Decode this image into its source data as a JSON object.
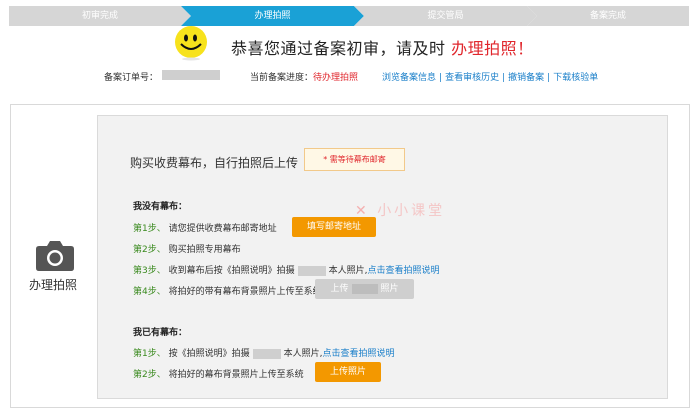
{
  "steps": [
    {
      "label": "初审完成",
      "color": "#d6d6d6"
    },
    {
      "label": "办理拍照",
      "color": "#1aa1d6"
    },
    {
      "label": "提交管局",
      "color": "#d6d6d6"
    },
    {
      "label": "备案完成",
      "color": "#d6d6d6"
    }
  ],
  "header": {
    "headline_prefix": "恭喜您通过备案初审，请及时 ",
    "headline_highlight": "办理拍照！",
    "order_label": "备案订单号：",
    "progress_label": "当前备案进度：",
    "progress_value": "待办理拍照",
    "links": [
      "浏览备案信息",
      "查看审核历史",
      "撤销备案",
      "下载核验单"
    ]
  },
  "side": {
    "title": "办理拍照"
  },
  "buy": {
    "title": "购买收费幕布，自行拍照后上传",
    "notice": "* 需等待幕布邮寄"
  },
  "no_screen": {
    "title": "我没有幕布：",
    "step1_prefix": "第1步、",
    "step1_text": "请您提供收费幕布邮寄地址",
    "step1_button": "填写邮寄地址",
    "step2_prefix": "第2步、",
    "step2_text": "购买拍照专用幕布",
    "step3_prefix": "第3步、",
    "step3_text_a": "收到幕布后按《拍照说明》拍摄",
    "step3_text_b": "本人照片,",
    "step3_link": "点击查看拍照说明",
    "step4_prefix": "第4步、",
    "step4_text": "将拍好的带有幕布背景照片上传至系统",
    "step4_button_a": "上传",
    "step4_button_b": "照片"
  },
  "has_screen": {
    "title": "我已有幕布：",
    "step1_prefix": "第1步、",
    "step1_text_a": "按《拍照说明》拍摄",
    "step1_text_b": "本人照片,",
    "step1_link": "点击查看拍照说明",
    "step2_prefix": "第2步、",
    "step2_text": "将拍好的幕布背景照片上传至系统",
    "step2_button": "上传照片"
  },
  "watermark": "小小课堂"
}
